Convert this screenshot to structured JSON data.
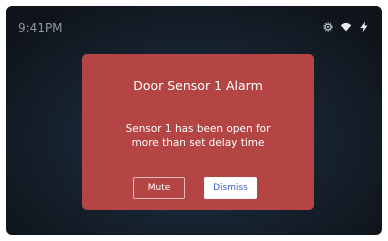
{
  "status_bar": {
    "time": "9:41PM",
    "icons": [
      "settings-icon",
      "wifi-icon",
      "power-bolt-icon"
    ]
  },
  "dialog": {
    "title": "Door Sensor 1 Alarm",
    "message_line1": "Sensor 1 has been open for",
    "message_line2": "more than set delay time",
    "mute_label": "Mute",
    "dismiss_label": "Dismiss"
  },
  "colors": {
    "dialog_background": "#b54545",
    "screen_background": "#16222f",
    "dismiss_text": "#3b5fc4",
    "status_text": "#8d96a3"
  }
}
